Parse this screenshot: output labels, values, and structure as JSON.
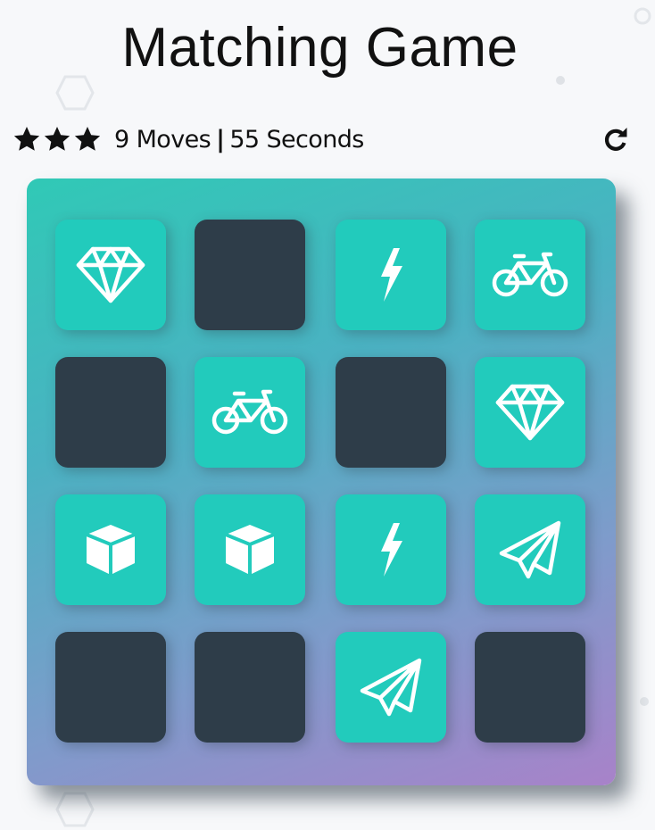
{
  "title": "Matching Game",
  "score": {
    "stars": 3,
    "moves": "9",
    "moves_label": "Moves",
    "separator": "|",
    "seconds": "55",
    "seconds_label": "Seconds",
    "restart_icon": "restart-icon"
  },
  "colors": {
    "card_open": "#22cbbc",
    "card_closed": "#2e3d49",
    "deck_gradient_start": "#30c9b6",
    "deck_gradient_end": "#a882c9"
  },
  "deck": {
    "cards": [
      {
        "state": "open",
        "icon": "diamond"
      },
      {
        "state": "closed",
        "icon": ""
      },
      {
        "state": "open",
        "icon": "bolt"
      },
      {
        "state": "open",
        "icon": "bicycle"
      },
      {
        "state": "closed",
        "icon": ""
      },
      {
        "state": "open",
        "icon": "bicycle"
      },
      {
        "state": "closed",
        "icon": ""
      },
      {
        "state": "open",
        "icon": "diamond"
      },
      {
        "state": "open",
        "icon": "cube"
      },
      {
        "state": "open",
        "icon": "cube"
      },
      {
        "state": "open",
        "icon": "bolt"
      },
      {
        "state": "open",
        "icon": "paper-plane"
      },
      {
        "state": "closed",
        "icon": ""
      },
      {
        "state": "closed",
        "icon": ""
      },
      {
        "state": "open",
        "icon": "paper-plane"
      },
      {
        "state": "closed",
        "icon": ""
      }
    ]
  }
}
